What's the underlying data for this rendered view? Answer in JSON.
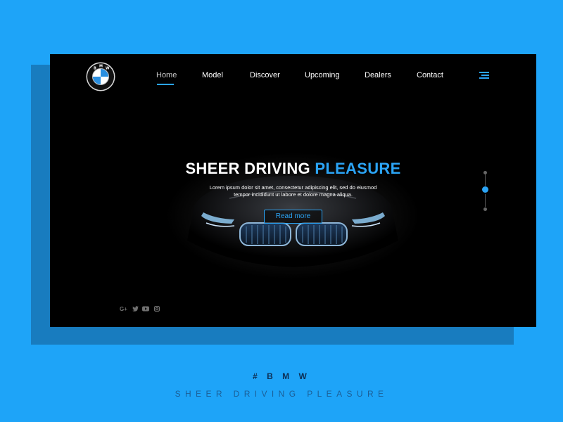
{
  "brand": {
    "logo_letters": "BMW"
  },
  "nav": {
    "items": [
      {
        "label": "Home",
        "active": true
      },
      {
        "label": "Model"
      },
      {
        "label": "Discover"
      },
      {
        "label": "Upcoming"
      },
      {
        "label": "Dealers"
      },
      {
        "label": "Contact"
      }
    ],
    "menu_icon": "hamburger-icon"
  },
  "hero": {
    "title_main": "SHEER DRIVING ",
    "title_accent": "PLEASURE",
    "subtitle_line1": "Lorem ipsum dolor sit amet, consectetur adipiscing elit, sed do eiusmod",
    "subtitle_line2": "tempor incididunt ut labore et dolore magna aliqua.",
    "cta_label": "Read more"
  },
  "pager": {
    "slides": 3,
    "active_index": 2
  },
  "socials": [
    {
      "name": "google-plus-icon",
      "glyph": "G+"
    },
    {
      "name": "twitter-icon",
      "glyph": ""
    },
    {
      "name": "youtube-icon",
      "glyph": ""
    },
    {
      "name": "instagram-icon",
      "glyph": ""
    }
  ],
  "footer": {
    "tag": "# B M W",
    "slogan": "SHEER DRIVING PLEASURE"
  },
  "colors": {
    "page_background": "#1ea4f8",
    "accent": "#2ba4f5",
    "card_background": "#000000",
    "shadow_card": "#187cbf"
  }
}
